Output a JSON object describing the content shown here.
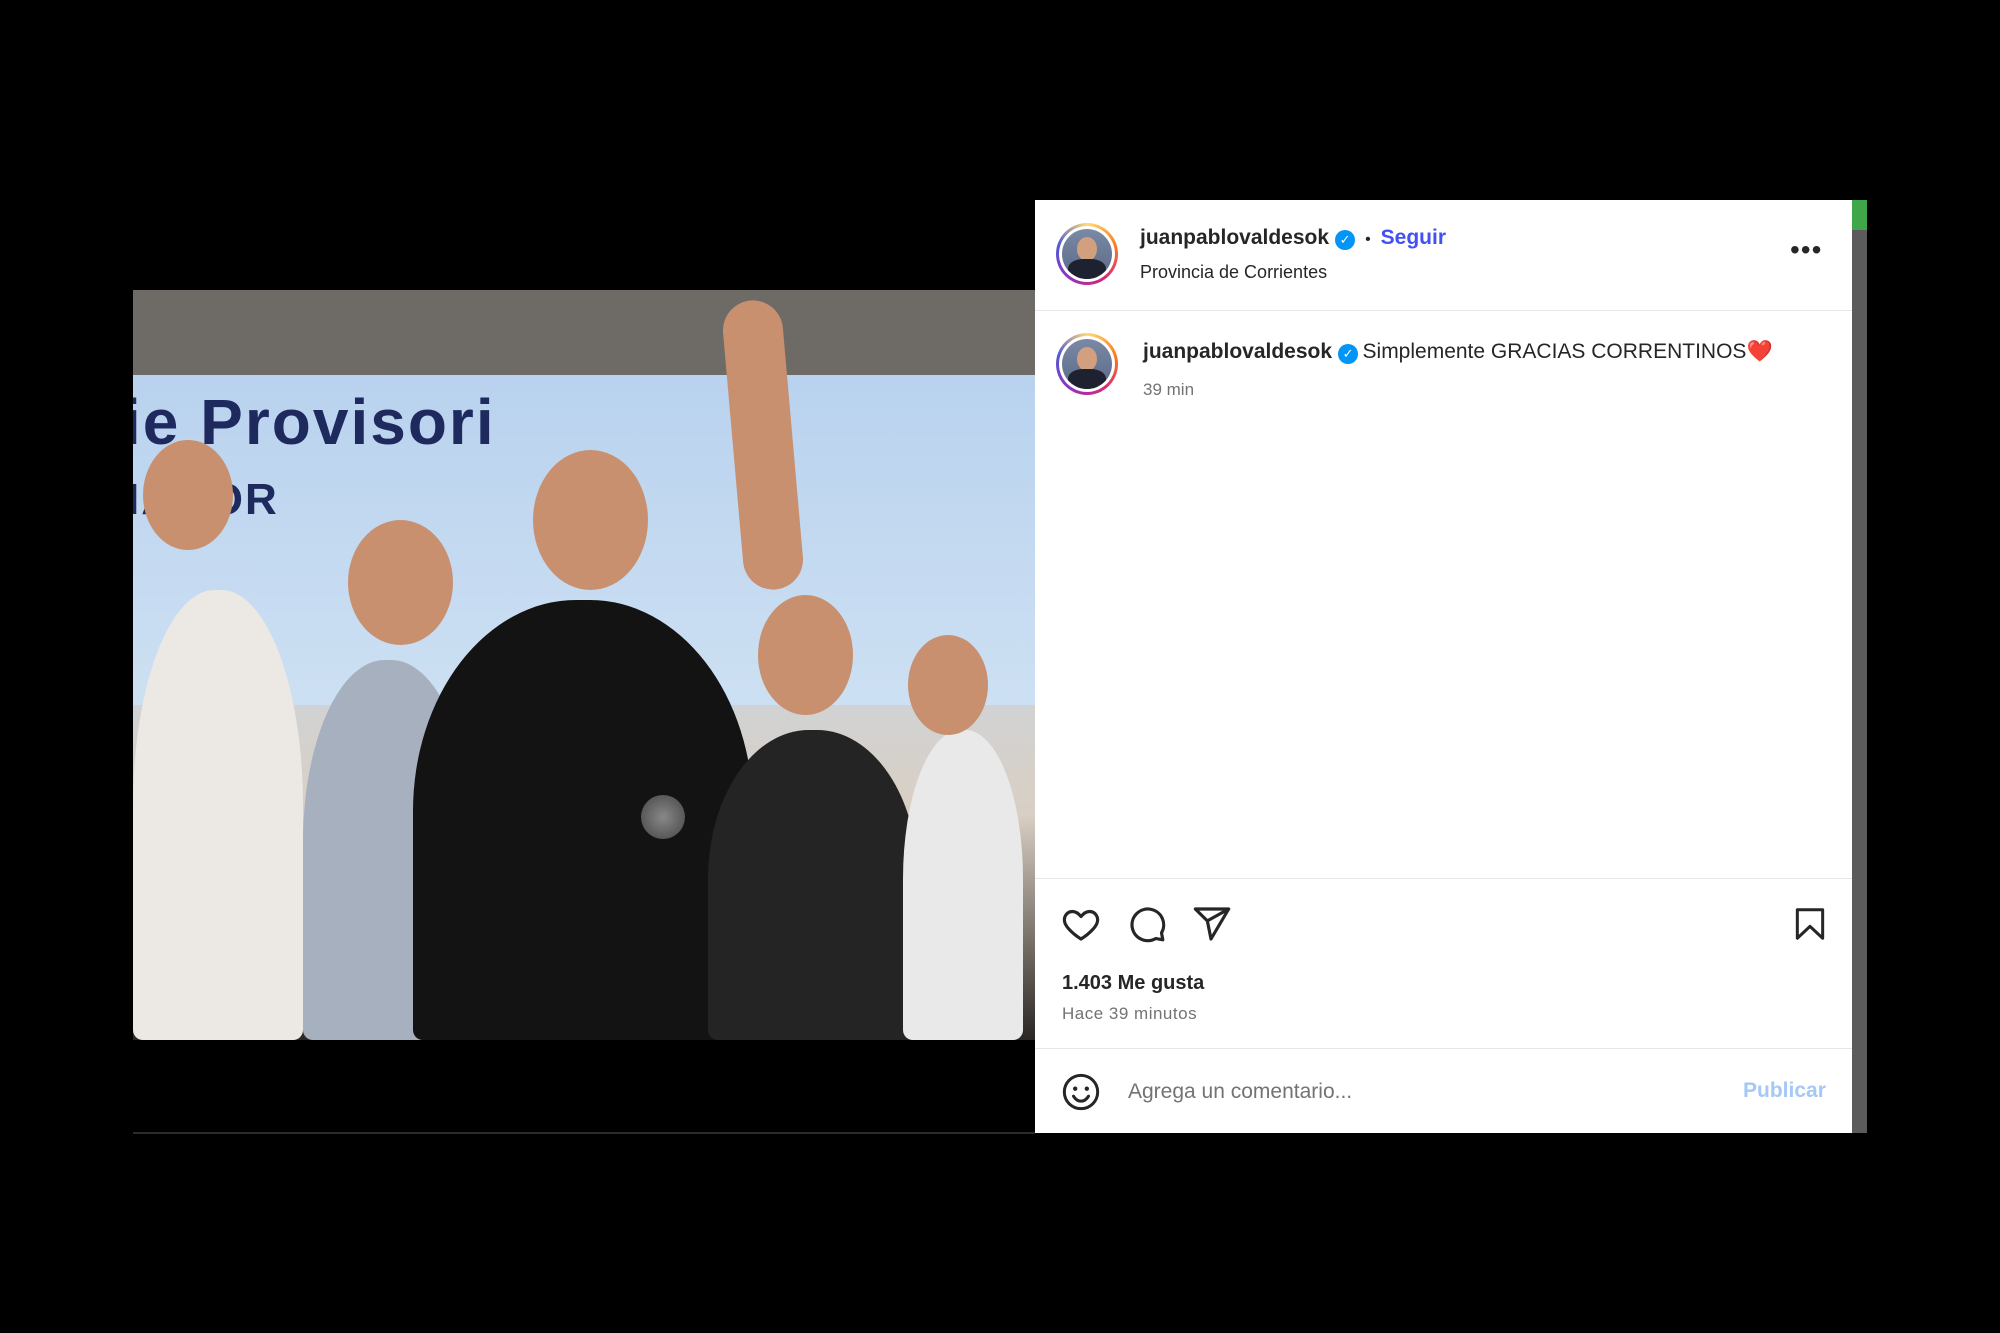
{
  "post": {
    "username": "juanpablovaldesok",
    "follow_label": "Seguir",
    "location": "Provincia de Corrientes",
    "more_label": "•••",
    "caption": {
      "username": "juanpablovaldesok",
      "text": "Simplemente GRACIAS CORRENTINOS",
      "emoji": "❤️",
      "time": "39 min"
    },
    "likes": "1.403 Me gusta",
    "posted_ago": "Hace 39 minutos",
    "comment": {
      "placeholder": "Agrega un comentario...",
      "publish_label": "Publicar"
    },
    "image": {
      "banner_text": "ie Provisori",
      "banner_subtext": "IADOR"
    }
  },
  "icons": [
    "heart-icon",
    "comment-icon",
    "share-icon",
    "bookmark-icon",
    "emoji-icon",
    "verified-icon",
    "more-icon"
  ]
}
